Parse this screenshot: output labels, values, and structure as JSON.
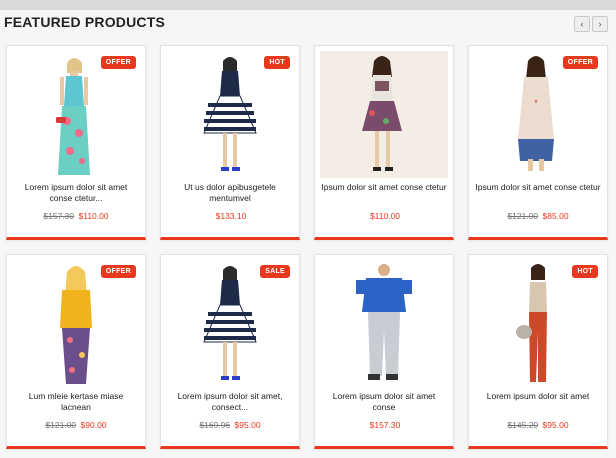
{
  "header": {
    "title": "FEATURED PRODUCTS",
    "prev_icon": "chevron-left-icon",
    "next_icon": "chevron-right-icon",
    "prev_glyph": "‹",
    "next_glyph": "›"
  },
  "colors": {
    "accent": "#e8391f"
  },
  "products": [
    {
      "name": "Lorem ipsum dolor sit amet conse ctetur...",
      "old_price": "$157.30",
      "price": "$110.00",
      "badge": "OFFER"
    },
    {
      "name": "Ut us dolor apibusgetele mentumvel",
      "old_price": "",
      "price": "$133.10",
      "badge": "HOT"
    },
    {
      "name": "Ipsum dolor sit amet conse ctetur",
      "old_price": "",
      "price": "$110.00",
      "badge": ""
    },
    {
      "name": "Ipsum dolor sit amet conse ctetur",
      "old_price": "$121.00",
      "price": "$85.00",
      "badge": "OFFER"
    },
    {
      "name": "Lum mleie kertase miase lacnean",
      "old_price": "$121.00",
      "price": "$90.00",
      "badge": "OFFER"
    },
    {
      "name": "Lorem ipsum dolor sit amet, consect...",
      "old_price": "$169.96",
      "price": "$95.00",
      "badge": "SALE"
    },
    {
      "name": "Lorem ipsum dolor sit amet conse",
      "old_price": "",
      "price": "$157.30",
      "badge": ""
    },
    {
      "name": "Lorem ipsum dolor sit amet",
      "old_price": "$145.20",
      "price": "$95.00",
      "badge": "HOT"
    }
  ]
}
